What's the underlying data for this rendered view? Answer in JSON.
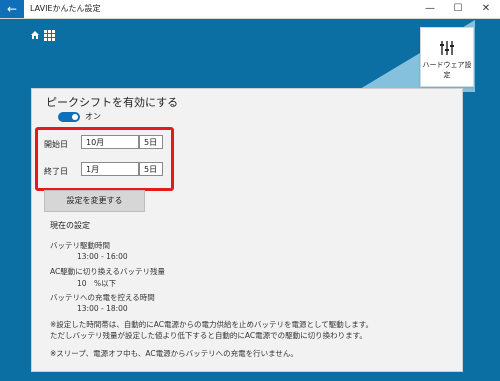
{
  "titlebar": {
    "back_glyph": "←",
    "title": "LAVIEかんたん設定",
    "min_glyph": "—",
    "max_glyph": "☐",
    "close_glyph": "✕"
  },
  "header": {
    "hardware_label": "ハードウェア設定"
  },
  "peak_shift": {
    "heading": "ピークシフトを有効にする",
    "toggle_state": "オン",
    "start_label": "開始日",
    "start_month": "10月",
    "start_day": "5日",
    "end_label": "終了日",
    "end_month": "1月",
    "end_day": "5日",
    "apply_label": "設定を変更する"
  },
  "current_settings": {
    "heading": "現在の設定",
    "battery_time_label": "バッテリ駆動時間",
    "battery_time_value": "13:00 - 16:00",
    "ac_threshold_label": "AC駆動に切り換えるバッテリ残量",
    "ac_threshold_value": "10　%以下",
    "charge_suppress_label": "バッテリへの充電を控える時間",
    "charge_suppress_value": "13:00 - 18:00",
    "note1_line1": "※設定した時間帯は、自動的にAC電源からの電力供給を止めバッテリを電源として駆動します。",
    "note1_line2": "ただしバッテリ残量が設定した値より低下すると自動的にAC電源での駆動に切り換わります。",
    "note2": "※スリープ、電源オフ中も、AC電源からバッテリへの充電を行いません。"
  },
  "colors": {
    "background": "#0b6fa4",
    "accent": "#0f6fb8",
    "highlight": "#e21b1b"
  }
}
